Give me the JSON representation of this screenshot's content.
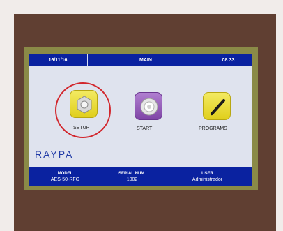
{
  "topbar": {
    "date": "16/11/16",
    "title": "MAIN",
    "time": "08:33"
  },
  "menu": {
    "setup_label": "SETUP",
    "start_label": "START",
    "programs_label": "PROGRAMS"
  },
  "brand": "RAYPA",
  "bottombar": {
    "model_header": "MODEL",
    "model_value": "AES-50-RFG",
    "serial_header": "SERIAL NUM.",
    "serial_value": "1002",
    "user_header": "USER",
    "user_value": "Administrador"
  },
  "colors": {
    "header_blue": "#0a22a0",
    "screen_bg": "#dfe3ee",
    "highlight_red": "#d2262c",
    "bezel": "#8a8a47",
    "panel": "#603f32"
  },
  "icons": {
    "setup": "nut-icon",
    "start": "power-knob-icon",
    "programs": "pen-icon"
  }
}
